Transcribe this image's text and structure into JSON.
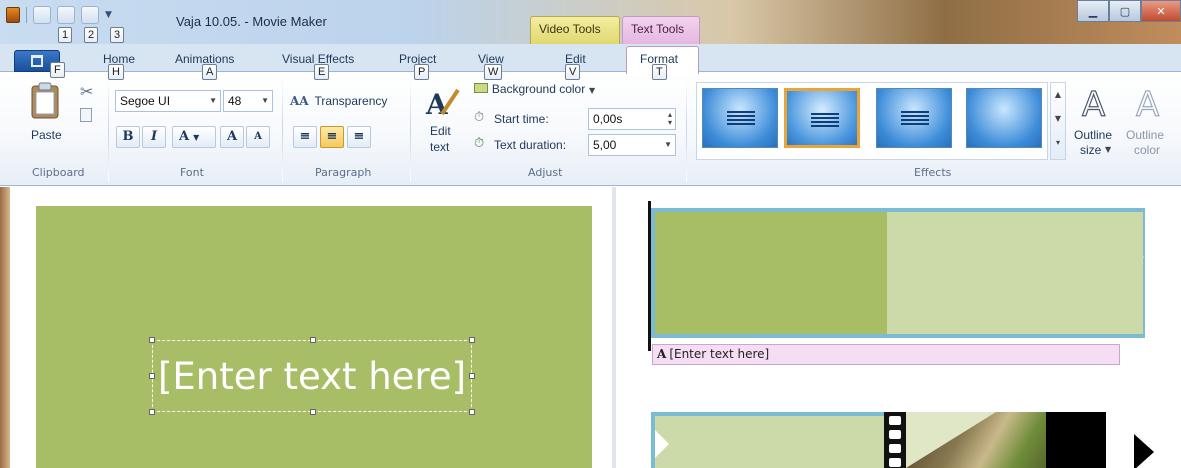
{
  "window": {
    "title": "Vaja 10.05. - Movie Maker",
    "contextual_tabs": [
      "Video Tools",
      "Text Tools"
    ],
    "keytips_qat": [
      "1",
      "2",
      "3"
    ]
  },
  "tabs": {
    "file_keytip": "F",
    "items": [
      {
        "label": "Home",
        "keytip": "H"
      },
      {
        "label": "Animations",
        "keytip": "A"
      },
      {
        "label": "Visual Effects",
        "keytip": "E"
      },
      {
        "label": "Project",
        "keytip": "P"
      },
      {
        "label": "View",
        "keytip": "W"
      },
      {
        "label": "Edit",
        "keytip": "V"
      },
      {
        "label": "Format",
        "keytip": "T"
      }
    ]
  },
  "ribbon": {
    "clipboard": {
      "paste": "Paste",
      "label": "Clipboard"
    },
    "font": {
      "family": "Segoe UI",
      "size": "48",
      "bold": "B",
      "italic": "I",
      "color": "A",
      "grow": "A",
      "shrink": "A",
      "label": "Font"
    },
    "paragraph": {
      "transparency": "Transparency",
      "label": "Paragraph"
    },
    "adjust": {
      "edit_text": "Edit\ntext",
      "edit_text_l1": "Edit",
      "edit_text_l2": "text",
      "background_color": "Background color",
      "start_time_label": "Start time:",
      "start_time_value": "0,00s",
      "duration_label": "Text duration:",
      "duration_value": "5,00",
      "label": "Adjust"
    },
    "effects": {
      "label": "Effects",
      "outline_size_l1": "Outline",
      "outline_size_l2": "size",
      "outline_color_l1": "Outline",
      "outline_color_l2": "color"
    }
  },
  "preview": {
    "placeholder_text": "[Enter text here]"
  },
  "storyboard": {
    "caption_text": "[Enter text here]"
  },
  "colors": {
    "preview_bg": "#a7be67",
    "clip_light": "#cbdaa8",
    "clip_border": "#7bbbd3",
    "caption_bg": "#f5ddf4",
    "selected_effect": "#e9a53a"
  }
}
